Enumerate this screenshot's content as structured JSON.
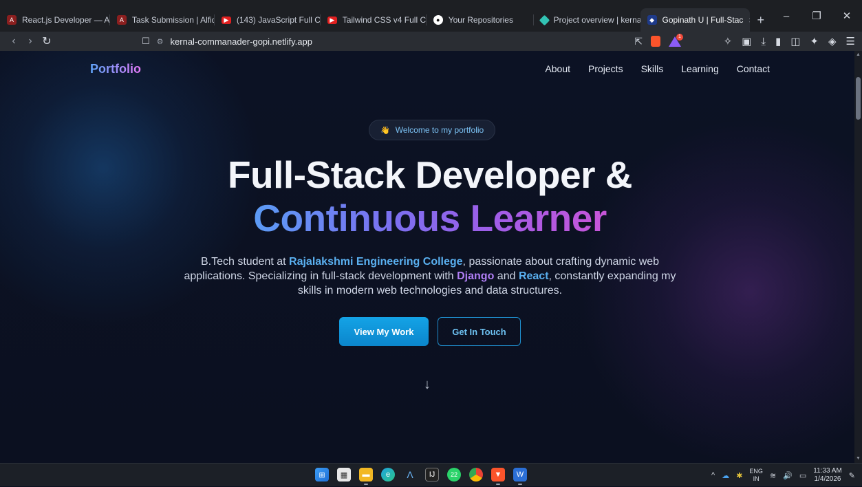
{
  "browser": {
    "tabs": [
      {
        "title": "React.js Developer — Alfid",
        "icon": "alfido-icon",
        "color": "#c0392b"
      },
      {
        "title": "Task Submission | Alfido Te",
        "icon": "alfido-icon",
        "color": "#c0392b"
      },
      {
        "title": "(143) JavaScript Full Cours",
        "icon": "youtube-icon",
        "color": "#ff0000"
      },
      {
        "title": "Tailwind CSS v4 Full Cours",
        "icon": "youtube-icon",
        "color": "#ff0000"
      },
      {
        "title": "Your Repositories",
        "icon": "github-icon",
        "color": "#ffffff"
      },
      {
        "title": "Project overview | kernal-c",
        "icon": "netlify-icon",
        "color": "#32c3b4"
      },
      {
        "title": "Gopinath U | Full-Stac",
        "icon": "portfolio-icon",
        "color": "#3b82f6",
        "active": true
      }
    ],
    "url": "kernal-commanader-gopi.netlify.app",
    "brave_badge": "1"
  },
  "page": {
    "brand": "Portfolio",
    "nav": [
      "About",
      "Projects",
      "Skills",
      "Learning",
      "Contact"
    ],
    "welcome_badge": "Welcome to my portfolio",
    "headline_line1": "Full-Stack Developer &",
    "headline_line2": "Continuous Learner",
    "description": {
      "part1": "B.Tech student at ",
      "college": "Rajalakshmi Engineering College",
      "part2": ", passionate about crafting dynamic web applications. Specializing in full-stack development with ",
      "django": "Django",
      "part3": " and ",
      "react": "React",
      "part4": ", constantly expanding my skills in modern web technologies and data structures."
    },
    "primary_button": "View My Work",
    "secondary_button": "Get In Touch",
    "colors": {
      "accent_blue": "#14a3e6",
      "accent_purple": "#a25ce6"
    }
  },
  "taskbar": {
    "whatsapp_badge": "22",
    "lang_top": "ENG",
    "lang_bottom": "IN",
    "time": "11:33 AM",
    "date": "1/4/2026"
  }
}
